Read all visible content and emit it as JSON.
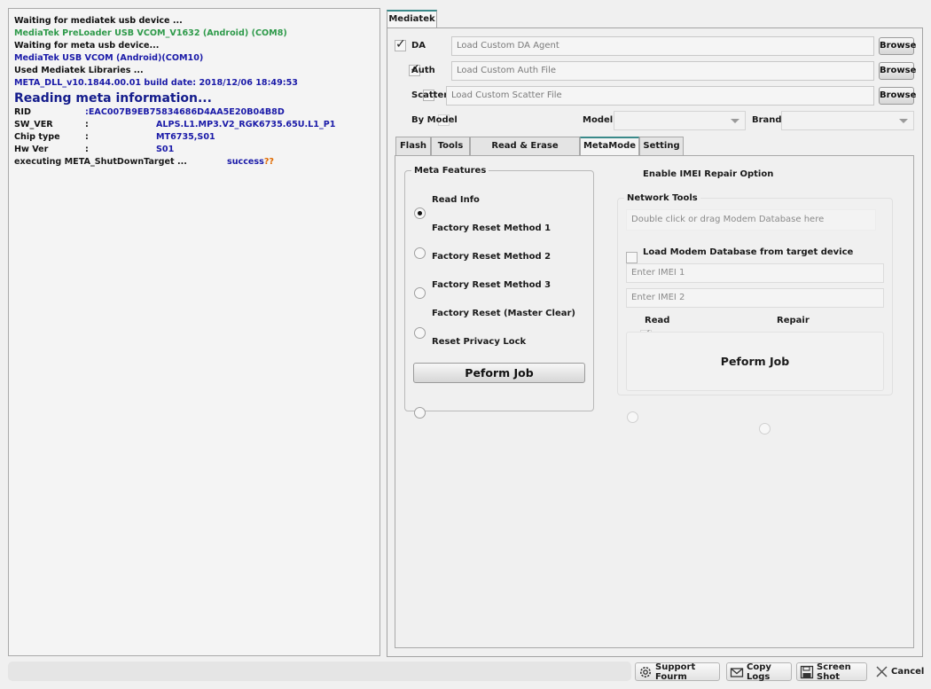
{
  "log": {
    "lines": [
      {
        "text": "Waiting for mediatek usb device ..."
      },
      {
        "text": "MediaTek PreLoader USB VCOM_V1632 (Android) (COM8)"
      },
      {
        "text": "Waiting for meta usb device..."
      },
      {
        "text": "MediaTek USB VCOM (Android)(COM10)"
      },
      {
        "text": "Used Mediatek Libraries ..."
      },
      {
        "text": "META_DLL_v10.1844.00.01 build date: 2018/12/06 18:49:53"
      }
    ],
    "heading": "Reading meta information...",
    "fields": [
      {
        "key": "RID",
        "sep": "",
        "value": ":EAC007B9EB75834686D4AA5E20B04B8D"
      },
      {
        "key": "SW_VER",
        "sep": ":",
        "value": "ALPS.L1.MP3.V2_RGK6735.65U.L1_P1"
      },
      {
        "key": "Chip type",
        "sep": ":",
        "value": "MT6735,S01"
      },
      {
        "key": "Hw Ver",
        "sep": ":",
        "value": "S01"
      }
    ],
    "final_label": "executing META_ShutDownTarget ...",
    "final_status": "success",
    "final_suffix": "??"
  },
  "main_tab": "Mediatek",
  "loaders": {
    "da": {
      "label": "DA",
      "checked": true,
      "placeholder": "Load Custom DA Agent",
      "button": "Browse"
    },
    "auth": {
      "label": "Auth",
      "checked": true,
      "placeholder": "Load Custom Auth File",
      "button": "Browse"
    },
    "scatter": {
      "label": "Scatter",
      "checked": false,
      "placeholder": "Load Custom Scatter File",
      "button": "Browse"
    }
  },
  "by_model": {
    "label": "By Model",
    "model_label": "Model",
    "brand_label": "Brand"
  },
  "tabs": [
    {
      "label": "Flash"
    },
    {
      "label": "Tools"
    },
    {
      "label": "Read & Erase Operation"
    },
    {
      "label": "MetaMode"
    },
    {
      "label": "Setting"
    }
  ],
  "meta_features": {
    "title": "Meta Features",
    "options": [
      {
        "label": "Read Info",
        "selected": true
      },
      {
        "label": "Factory Reset Method 1",
        "selected": false
      },
      {
        "label": "Factory Reset Method 2",
        "selected": false
      },
      {
        "label": "Factory Reset Method 3",
        "selected": false
      },
      {
        "label": "Factory Reset (Master Clear)",
        "selected": false
      },
      {
        "label": "Reset Privacy Lock",
        "selected": false
      }
    ],
    "button": "Peform Job"
  },
  "imei": {
    "enable_label": "Enable IMEI Repair Option",
    "network_title": "Network Tools",
    "modem_placeholder": "Double click or drag Modem Database  here",
    "load_modem_label": "Load Modem Database from target device",
    "imei1_placeholder": "Enter IMEI 1",
    "imei2_placeholder": "Enter IMEI 2",
    "read_label": "Read",
    "repair_label": "Repair",
    "button": "Peform Job"
  },
  "footer": {
    "support": "Support Fourm",
    "copy": "Copy Logs",
    "screenshot": "Screen Shot",
    "cancel": "Cancel"
  },
  "colors": {
    "log_green": "#2e9a4a",
    "log_blue": "#1a1aa8",
    "heading_blue": "#141c8c",
    "tab_accent": "#3a8a8a",
    "warning_orange": "#e06a00"
  }
}
